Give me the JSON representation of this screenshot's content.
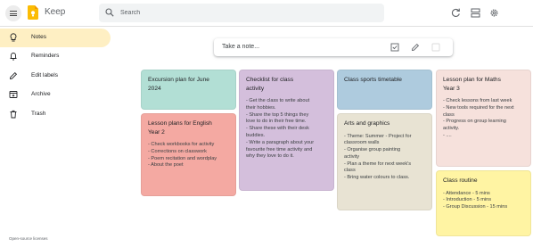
{
  "app": {
    "title": "Keep"
  },
  "search": {
    "placeholder": "Search"
  },
  "header_icons": [
    "refresh-icon",
    "list-view-icon",
    "settings-icon"
  ],
  "sidebar": {
    "items": [
      {
        "label": "Notes",
        "icon": "lightbulb-icon",
        "active": true
      },
      {
        "label": "Reminders",
        "icon": "bell-icon",
        "active": false
      },
      {
        "label": "Edit labels",
        "icon": "pencil-icon",
        "active": false
      },
      {
        "label": "Archive",
        "icon": "archive-icon",
        "active": false
      },
      {
        "label": "Trash",
        "icon": "trash-icon",
        "active": false
      }
    ],
    "footer": "Open-source licenses"
  },
  "take_note": {
    "placeholder": "Take a note..."
  },
  "colors": {
    "accent_active": "#feefc3",
    "brand_yellow": "#fbbc04",
    "teal": "#b2dfd5",
    "red": "#f4a9a2",
    "purple": "#d4bfdc",
    "blue": "#aecbde",
    "sand": "#e8e3d3",
    "peach": "#f6e1dc",
    "yellow": "#fff4a3"
  },
  "notes": [
    {
      "title_lines": [
        "Excursion plan for June",
        "2024"
      ],
      "body": []
    },
    {
      "title_lines": [
        "Lesson plans for English",
        "Year 2"
      ],
      "body": [
        "- Check workbooks for activity",
        "- Corrections on classwork",
        "- Poem recitation and wordplay",
        "- About the poet"
      ]
    },
    {
      "title_lines": [
        "Checklist for class",
        "activity"
      ],
      "body": [
        "- Get the class to write about",
        "their hobbies.",
        "- Share the top 5 things they",
        "love to do in their free time.",
        "- Share these with their desk",
        "buddies.",
        "- Write a paragraph about your",
        "favourite free time activity and",
        "why they love to do it."
      ]
    },
    {
      "title_lines": [
        "Class sports timetable"
      ],
      "body": []
    },
    {
      "title_lines": [
        "Arts and graphics"
      ],
      "body": [
        "- Theme: Summer - Project for",
        "classroom walls",
        "- Organise group painting",
        "activity",
        "- Plan a theme for next week's",
        "class",
        "- Bring water colours to class."
      ]
    },
    {
      "title_lines": [
        "Lesson plan for Maths",
        "Year 3"
      ],
      "body": [
        "- Check lessons from last week",
        "- New tools required for the next",
        "class",
        "- Progress on group learning",
        "activity.",
        "- ...."
      ]
    },
    {
      "title_lines": [
        "Class routine"
      ],
      "body": [
        "- Attendance - 5 mins",
        "- Introduction - 5 mins",
        "- Group Discussion - 15 mins"
      ]
    }
  ]
}
